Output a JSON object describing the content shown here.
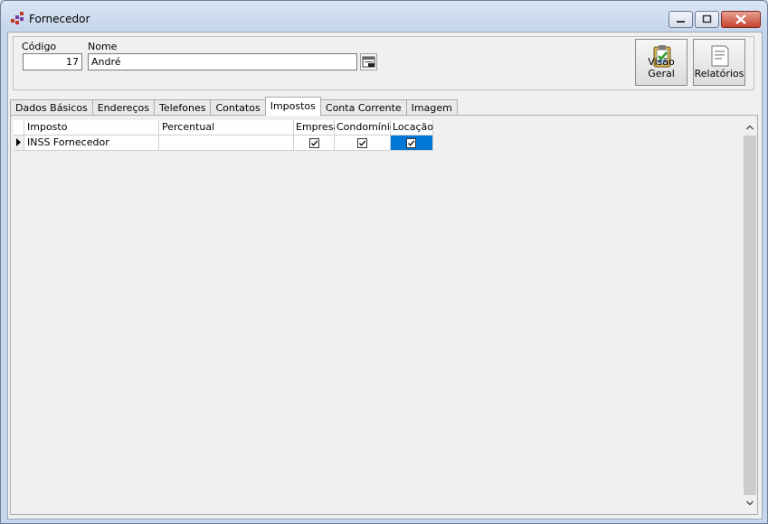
{
  "window": {
    "title": "Fornecedor"
  },
  "header": {
    "codigo_label": "Código",
    "codigo_value": "17",
    "nome_label": "Nome",
    "nome_value": "André",
    "visao_geral_label": "Visão Geral",
    "relatorios_label": "Relatórios"
  },
  "tabs": [
    {
      "label": "Dados Básicos"
    },
    {
      "label": "Endereços"
    },
    {
      "label": "Telefones"
    },
    {
      "label": "Contatos"
    },
    {
      "label": "Impostos"
    },
    {
      "label": "Conta Corrente"
    },
    {
      "label": "Imagem"
    }
  ],
  "active_tab": "Impostos",
  "grid": {
    "columns": [
      "Imposto",
      "Percentual",
      "Empresa",
      "Condomínio",
      "Locação"
    ],
    "rows": [
      {
        "imposto": "INSS Fornecedor",
        "percentual": "",
        "empresa": true,
        "condominio": true,
        "locacao": true
      }
    ]
  },
  "colors": {
    "selection": "#0078d7",
    "close_button": "#c4432f"
  }
}
